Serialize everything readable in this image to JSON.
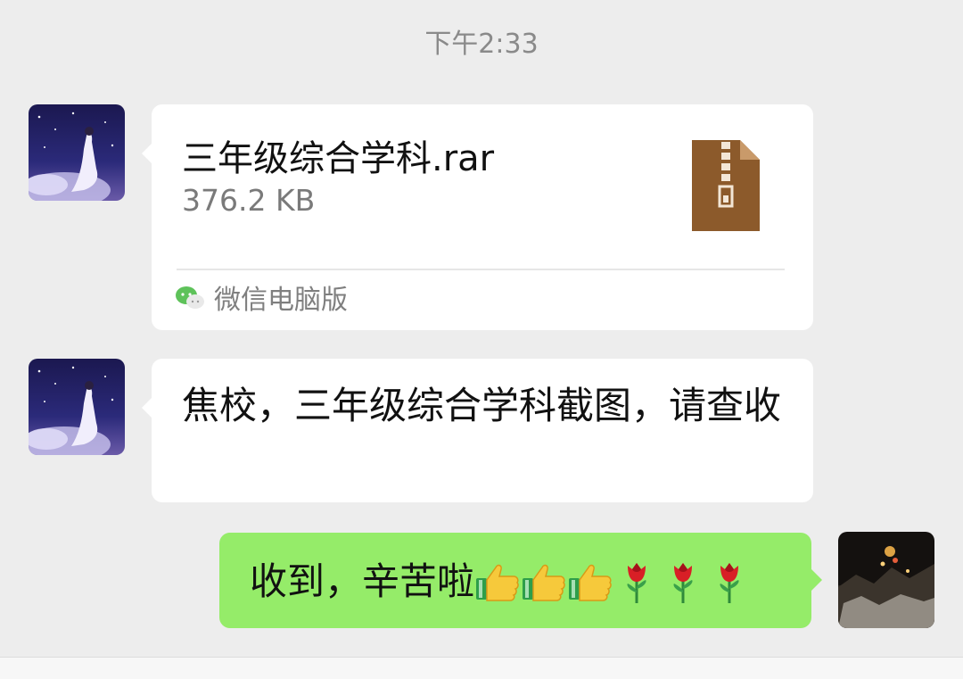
{
  "chat": {
    "timestamp": "下午2:33",
    "messages": [
      {
        "type": "file",
        "file_name": "三年级综合学科.rar",
        "file_size": "376.2 KB",
        "file_icon": "zip-archive-icon",
        "source": "微信电脑版",
        "source_icon": "wechat-icon"
      },
      {
        "type": "text",
        "text": "焦校，三年级综合学科截图，请查收"
      },
      {
        "type": "text",
        "text": "收到，辛苦啦",
        "emojis": [
          "thumbs-up-icon",
          "thumbs-up-icon",
          "thumbs-up-icon",
          "rose-icon",
          "rose-icon",
          "rose-icon"
        ]
      }
    ]
  },
  "colors": {
    "background": "#ededed",
    "incoming_bubble": "#ffffff",
    "outgoing_bubble": "#95ec69",
    "archive_icon": "#8c5a2b"
  }
}
